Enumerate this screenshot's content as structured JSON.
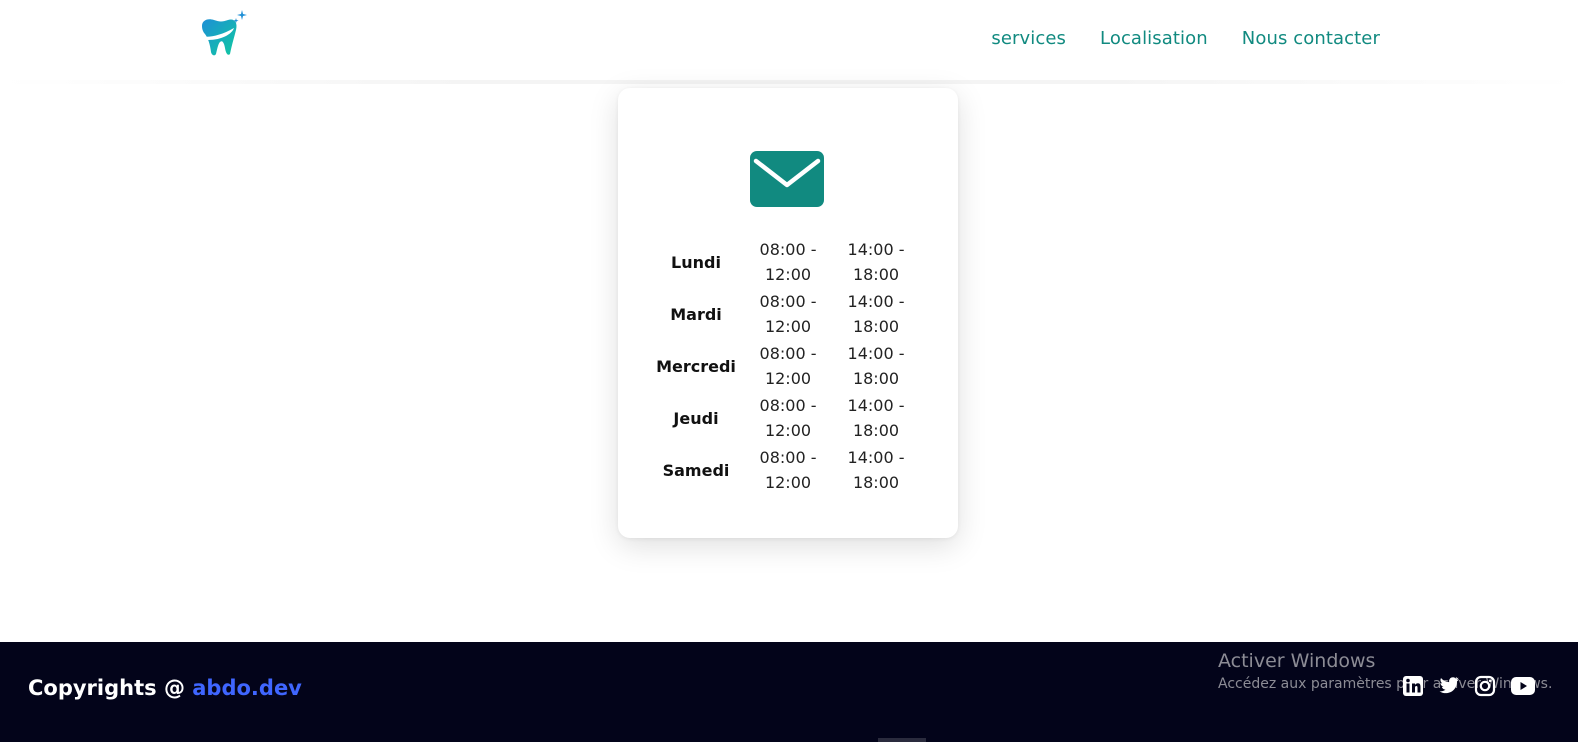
{
  "header": {
    "logo_name": "tooth-logo",
    "nav": [
      {
        "label": "services"
      },
      {
        "label": "Localisation"
      },
      {
        "label": "Nous contacter"
      }
    ]
  },
  "card": {
    "icon": "envelope-icon",
    "accent_color": "#118a80",
    "schedule": [
      {
        "day": "Lundi",
        "morning_start": "08:00 -",
        "morning_end": "12:00",
        "afternoon_start": "14:00 -",
        "afternoon_end": "18:00"
      },
      {
        "day": "Mardi",
        "morning_start": "08:00 -",
        "morning_end": "12:00",
        "afternoon_start": "14:00 -",
        "afternoon_end": "18:00"
      },
      {
        "day": "Mercredi",
        "morning_start": "08:00 -",
        "morning_end": "12:00",
        "afternoon_start": "14:00 -",
        "afternoon_end": "18:00"
      },
      {
        "day": "Jeudi",
        "morning_start": "08:00 -",
        "morning_end": "12:00",
        "afternoon_start": "14:00 -",
        "afternoon_end": "18:00"
      },
      {
        "day": "Samedi",
        "morning_start": "08:00 -",
        "morning_end": "12:00",
        "afternoon_start": "14:00 -",
        "afternoon_end": "18:00"
      }
    ]
  },
  "footer": {
    "copyright_prefix": "Copyrights @ ",
    "copyright_brand": "abdo.dev",
    "brand_color": "#3f66ff",
    "background_color": "#03041a",
    "activation_title": "Activer Windows",
    "activation_subtitle": "Accédez aux paramètres pour activer Windows.",
    "social_icons": [
      "linkedin-icon",
      "twitter-icon",
      "instagram-icon",
      "youtube-icon"
    ]
  }
}
